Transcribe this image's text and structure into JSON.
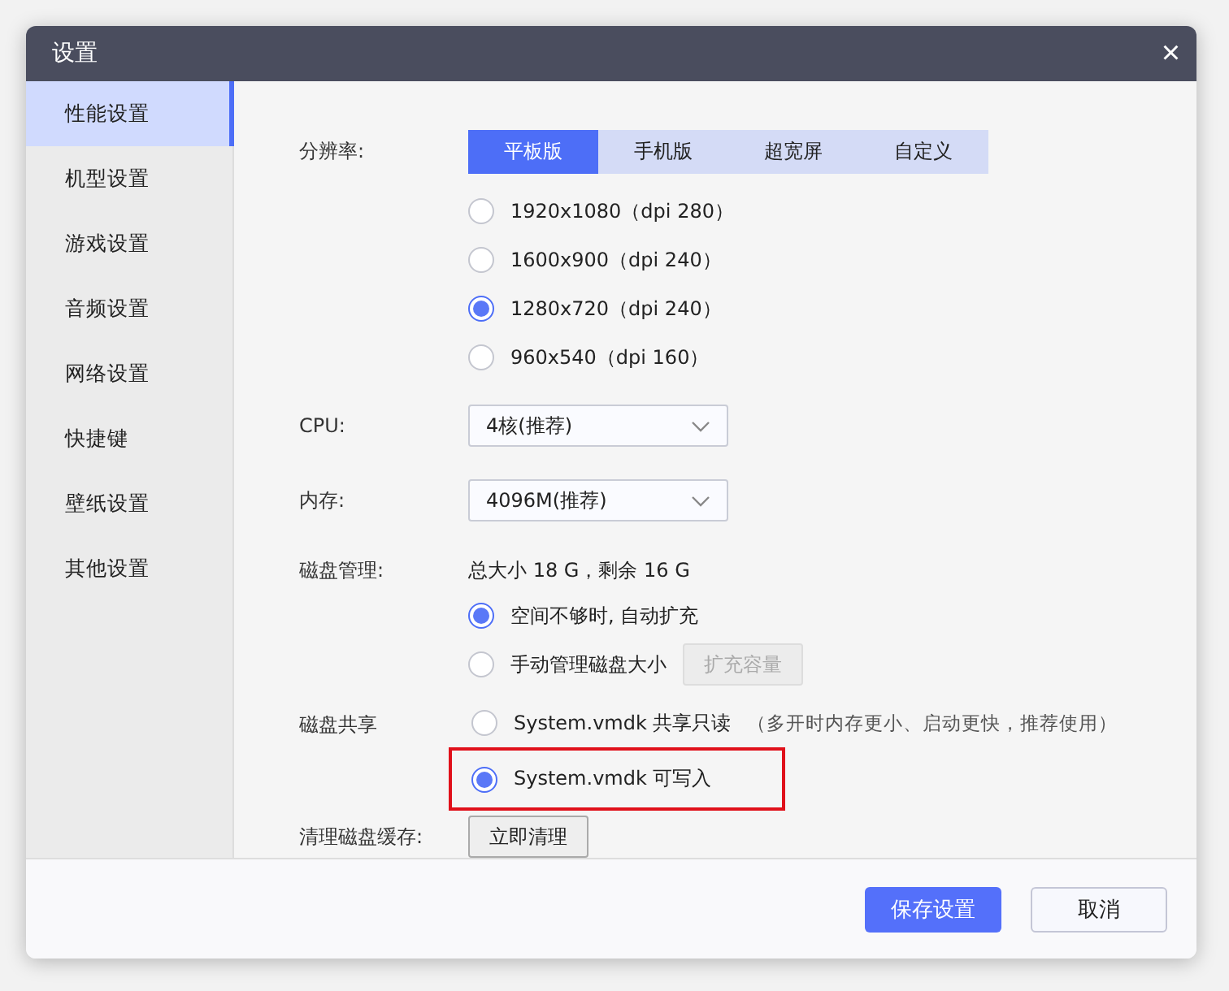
{
  "window": {
    "title": "设置",
    "close": "×"
  },
  "sidebar": {
    "items": [
      {
        "label": "性能设置",
        "selected": true
      },
      {
        "label": "机型设置",
        "selected": false
      },
      {
        "label": "游戏设置",
        "selected": false
      },
      {
        "label": "音频设置",
        "selected": false
      },
      {
        "label": "网络设置",
        "selected": false
      },
      {
        "label": "快捷键",
        "selected": false
      },
      {
        "label": "壁纸设置",
        "selected": false
      },
      {
        "label": "其他设置",
        "selected": false
      }
    ]
  },
  "resolution": {
    "label": "分辨率:",
    "tabs": [
      {
        "label": "平板版",
        "selected": true
      },
      {
        "label": "手机版",
        "selected": false
      },
      {
        "label": "超宽屏",
        "selected": false
      },
      {
        "label": "自定义",
        "selected": false
      }
    ],
    "options": [
      {
        "label": "1920x1080（dpi 280）",
        "selected": false
      },
      {
        "label": "1600x900（dpi 240）",
        "selected": false
      },
      {
        "label": "1280x720（dpi 240）",
        "selected": true
      },
      {
        "label": "960x540（dpi 160）",
        "selected": false
      }
    ]
  },
  "cpu": {
    "label": "CPU:",
    "value": "4核(推荐)"
  },
  "memory": {
    "label": "内存:",
    "value": "4096M(推荐)"
  },
  "disk": {
    "label": "磁盘管理:",
    "summary": "总大小 18 G，剩余 16 G",
    "options": [
      {
        "label": "空间不够时, 自动扩充",
        "selected": true
      },
      {
        "label": "手动管理磁盘大小",
        "selected": false,
        "button": {
          "label": "扩充容量",
          "disabled": true
        }
      }
    ]
  },
  "disk_share": {
    "label": "磁盘共享",
    "options": [
      {
        "label": "System.vmdk 共享只读",
        "note": "（多开时内存更小、启动更快，推荐使用）",
        "selected": false
      },
      {
        "label": "System.vmdk 可写入",
        "selected": true,
        "highlighted": true
      }
    ]
  },
  "cache": {
    "label": "清理磁盘缓存:",
    "button": "立即清理"
  },
  "footer": {
    "buttons": [
      {
        "label": "保存设置",
        "kind": "primary"
      },
      {
        "label": "取消",
        "kind": "secondary"
      }
    ]
  }
}
